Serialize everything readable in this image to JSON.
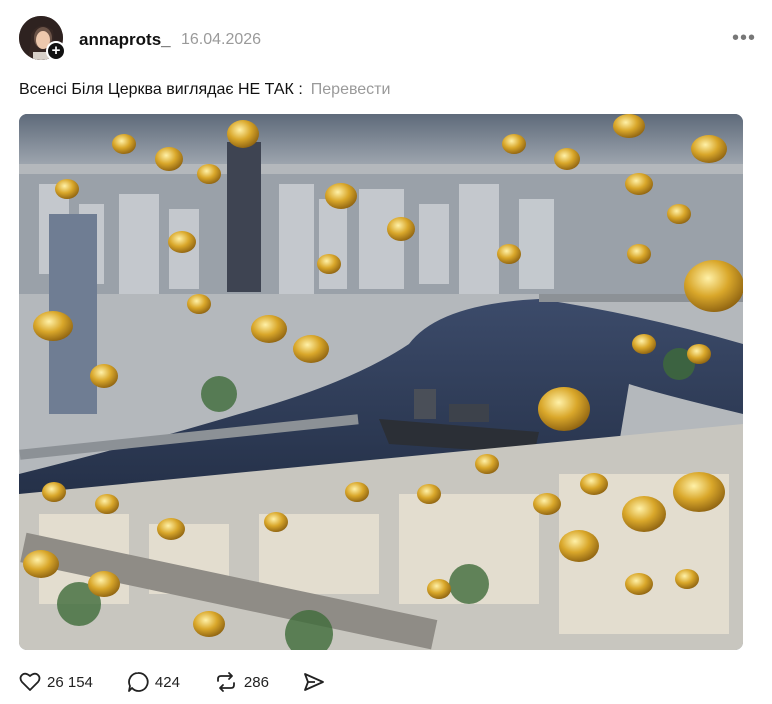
{
  "post": {
    "author": {
      "username": "annaprots_",
      "follow_symbol": "+"
    },
    "date": "16.04.2026",
    "more_symbol": "•••",
    "caption": "Всенсі Біля Церква виглядає НЕ ТАК :",
    "translate_label": "Перевести",
    "image": {
      "icon": "photo-image"
    },
    "stats": {
      "likes": "26 154",
      "comments": "424",
      "reposts": "286"
    },
    "icons": {
      "like": "heart-icon",
      "comment": "comment-icon",
      "repost": "repost-icon",
      "share": "send-icon"
    },
    "colors": {
      "text": "#111111",
      "muted": "#9a9a9a",
      "gold": "#d9a72a",
      "water": "#2c3a55"
    }
  }
}
